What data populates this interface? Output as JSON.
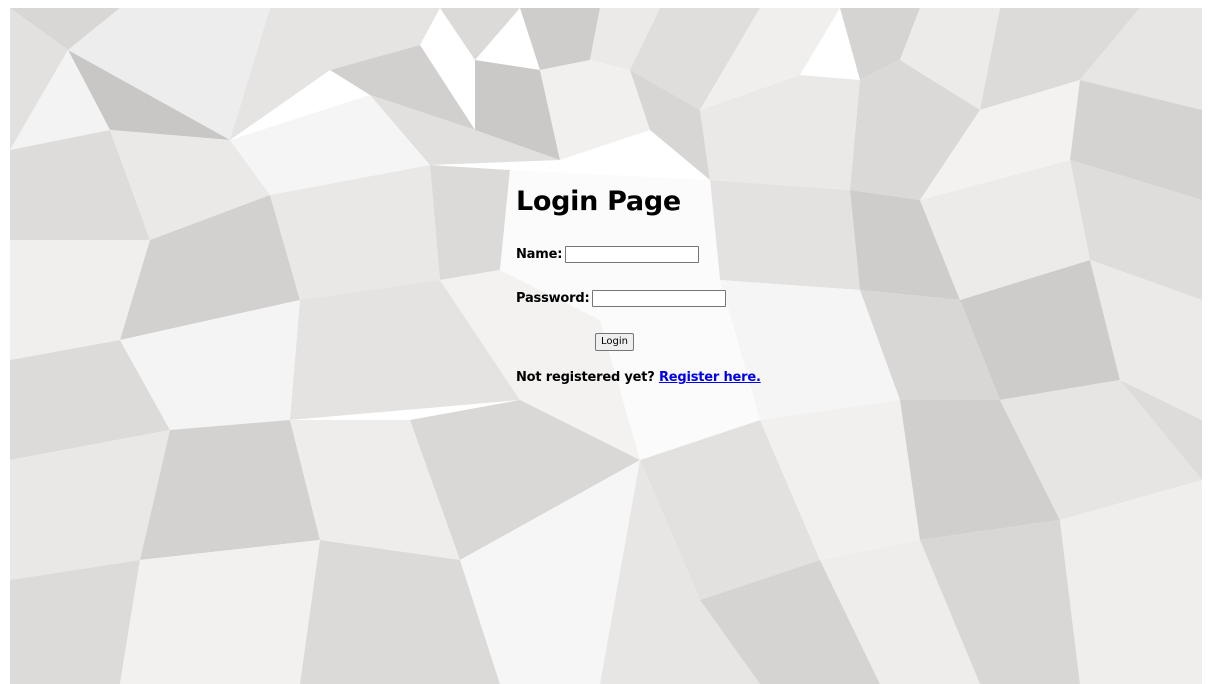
{
  "page": {
    "title": "Login Page"
  },
  "form": {
    "name_label": "Name:",
    "name_value": "",
    "password_label": "Password:",
    "password_value": "",
    "login_button": "Login"
  },
  "footer": {
    "prompt": "Not registered yet?",
    "register_link": "Register here."
  },
  "colors": {
    "background": "#ffffff",
    "link": "#0000ee",
    "text": "#000000"
  }
}
